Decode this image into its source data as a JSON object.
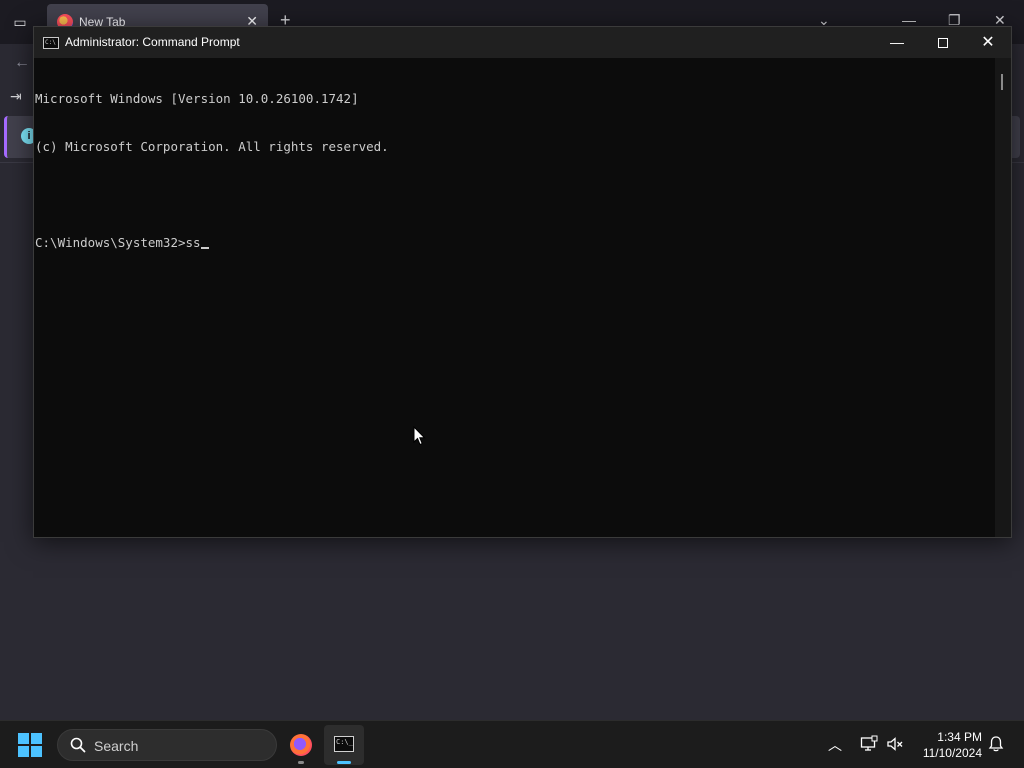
{
  "browser": {
    "tab_title": "New Tab",
    "tab_close": "✕",
    "new_tab": "+",
    "list_all_tabs": "▭",
    "back": "←",
    "sign_in": "⇥",
    "info": "i",
    "controls": {
      "chevron": "⌄",
      "minimize": "—",
      "restore": "❐",
      "close": "✕"
    }
  },
  "cmd": {
    "title": "Administrator: Command Prompt",
    "icon_text": "C:\\",
    "lines": [
      "Microsoft Windows [Version 10.0.26100.1742]",
      "(c) Microsoft Corporation. All rights reserved.",
      "",
      "C:\\Windows\\System32>ss"
    ],
    "controls": {
      "minimize": "—",
      "close": "✕"
    }
  },
  "taskbar": {
    "search_label": "Search",
    "tray_chevron": "︿",
    "time": "1:34 PM",
    "date": "11/10/2024",
    "cmd_icon_text": "C:\\_"
  },
  "colors": {
    "accent": "#4cc2ff",
    "terminal_bg": "#0c0c0c",
    "terminal_text": "#cccccc"
  }
}
